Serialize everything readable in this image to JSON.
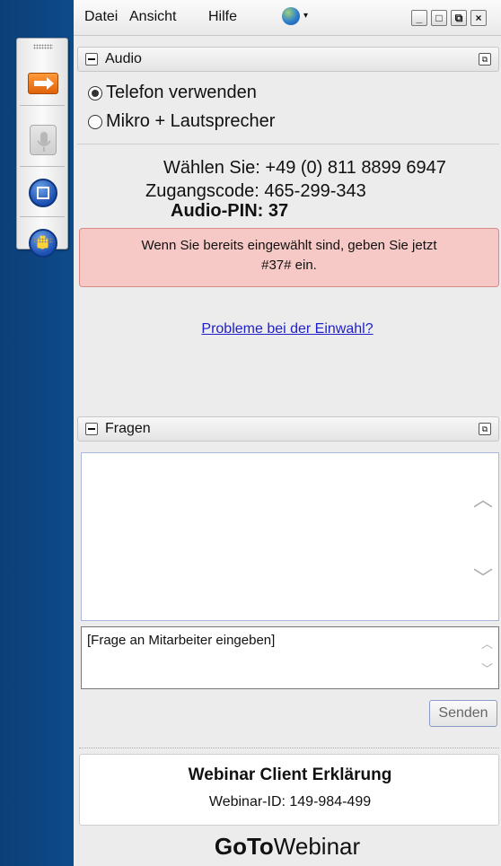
{
  "menu": {
    "datei": "Datei",
    "ansicht": "Ansicht",
    "hilfe": "Hilfe"
  },
  "window_controls": {
    "minimize": "_",
    "maximize": "□",
    "restore": "⧉",
    "close": "×"
  },
  "audio": {
    "title": "Audio",
    "option_phone": "Telefon verwenden",
    "option_mic": "Mikro + Lautsprecher",
    "dial_line": "Wählen Sie: +49 (0) 811 8899 6947",
    "access_code": "Zugangscode: 465-299-343",
    "audio_pin": "Audio-PIN: 37",
    "info_line1": "Wenn Sie bereits eingewählt sind, geben Sie jetzt",
    "info_line2": "#37# ein.",
    "help_link": "Probleme bei der Einwahl?"
  },
  "questions": {
    "title": "Fragen",
    "input_placeholder": "[Frage an Mitarbeiter eingeben]",
    "send_label": "Senden"
  },
  "webinar": {
    "title": "Webinar Client Erklärung",
    "id_line": "Webinar-ID: 149-984-499"
  },
  "brand": {
    "part1": "GoTo",
    "part2": "Webinar"
  },
  "icons": {
    "globe": "globe-icon",
    "arrow": "arrow-right-icon",
    "mic": "microphone-icon",
    "stop": "stop-screen-icon",
    "hand": "raise-hand-icon"
  },
  "colors": {
    "alert_bg": "#f7c9c6",
    "link": "#1f1fc7",
    "arrow_button": "#f07a1a",
    "background": "#0d4a86"
  }
}
